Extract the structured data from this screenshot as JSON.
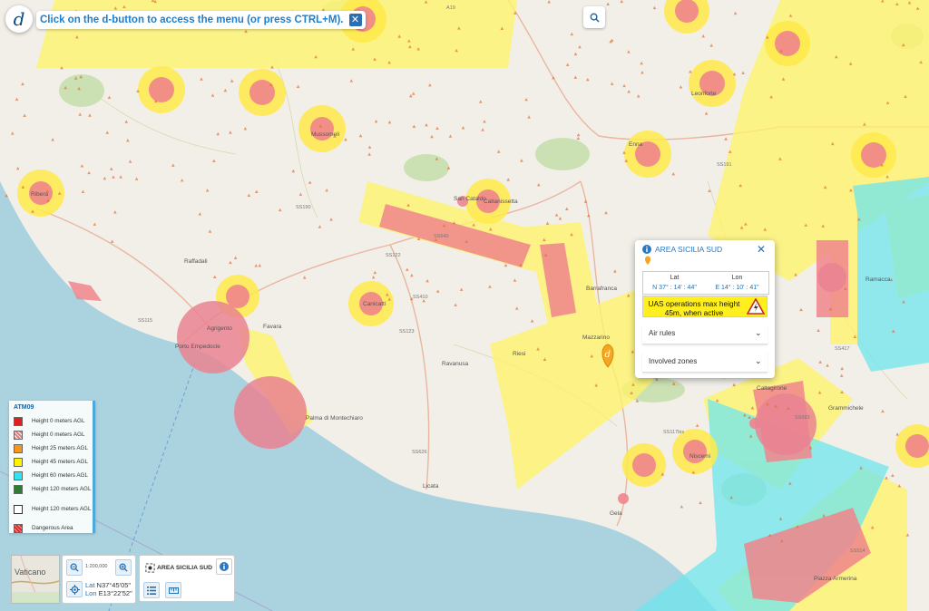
{
  "topbar": {
    "hint": "Click on the d-button to access the menu (or press CTRL+M).",
    "close_label": "✕"
  },
  "map": {
    "labels": [
      "Ribera",
      "Mussomeli",
      "Caltanissetta",
      "San Cataldo",
      "Canicattì",
      "Agrigento",
      "Porto Empedocle",
      "Favara",
      "Palma di Montechiaro",
      "Licata",
      "Gela",
      "Riesi",
      "Mazzarino",
      "Barrafranca",
      "Niscemi",
      "Caltagirone",
      "Grammichele",
      "Ramacca",
      "Enna",
      "Leonforte",
      "Raffadali",
      "Ravanusa",
      "Piazza Armerina"
    ],
    "road_labels": [
      "SS640",
      "SS122",
      "SS115",
      "SS191",
      "SS626",
      "SS117bis",
      "SS417",
      "SS514",
      "SS683",
      "A19",
      "SS190",
      "SS123",
      "SS410"
    ],
    "colors": {
      "yellow_zone": "#fff46a",
      "red_zone": "#f0858c",
      "cyan_zone": "#6fe6ee",
      "sea": "#aad3df",
      "land": "#f2efe9"
    },
    "marker_icon": "drone-location-pin-icon"
  },
  "search": {
    "icon": "search-icon"
  },
  "popup": {
    "title": "AREA SICILIA SUD",
    "lat_label": "Lat",
    "lon_label": "Lon",
    "lat_value": "N 37° : 14' : 44\"",
    "lon_value": "E 14° : 10' : 41\"",
    "uas_text": "UAS operations max height 45m, when active",
    "air_rules": "Air rules",
    "involved_zones": "Involved zones"
  },
  "legend": {
    "title": "ATM09",
    "items": [
      {
        "label": "Height 0 meters AGL",
        "color": "#e02020"
      },
      {
        "label": "Height 0 meters AGL",
        "color": "#e08080"
      },
      {
        "label": "Height 25 meters AGL",
        "color": "#f5961e"
      },
      {
        "label": "Height 45 meters AGL",
        "color": "#fff200"
      },
      {
        "label": "Height 60 meters AGL",
        "color": "#2fe6f0"
      },
      {
        "label": "Height 120 meters AGL",
        "color": "#2e7d32"
      },
      {
        "label": "Height 120 meters AGL",
        "color": "#ffffff"
      },
      {
        "label": "Dangerous Area",
        "color": "#d32f2f"
      }
    ]
  },
  "controls": {
    "minimap_label": "Vaticano",
    "scale": "1:200,000",
    "lat_label": "Lat",
    "lat_value": "N37°45'05\"",
    "lon_label": "Lon",
    "lon_value": "E13°22'52\"",
    "area_name": "AREA SICILIA SUD"
  }
}
